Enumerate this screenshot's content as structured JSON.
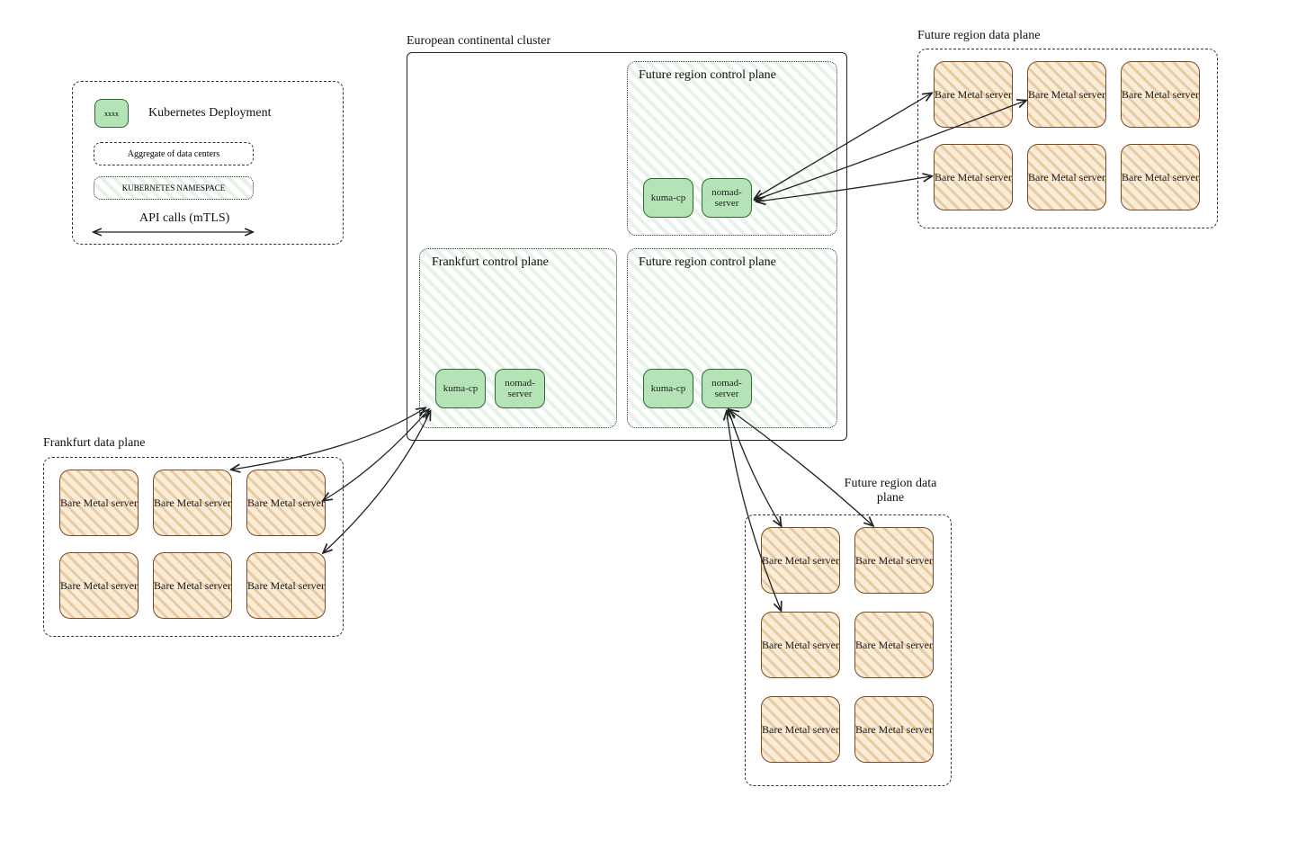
{
  "cluster": {
    "title": "European continental cluster"
  },
  "control_planes": [
    {
      "title": "Frankfurt control plane",
      "deployments": [
        "kuma-cp",
        "nomad-server"
      ]
    },
    {
      "title": "Future region control plane",
      "deployments": [
        "kuma-cp",
        "nomad-server"
      ]
    },
    {
      "title": "Future region control plane",
      "deployments": [
        "kuma-cp",
        "nomad-server"
      ]
    }
  ],
  "data_planes": {
    "frankfurt": {
      "title": "Frankfurt data plane",
      "server_label": "Bare Metal server",
      "server_count": 6
    },
    "future_top": {
      "title": "Future region data plane",
      "server_label": "Bare Metal server",
      "server_count": 6
    },
    "future_bottom": {
      "title": "Future region data plane",
      "server_label": "Bare Metal server",
      "server_count": 6
    }
  },
  "legend": {
    "deployment_swatch_text": "xxxx",
    "deployment_label": "Kubernetes Deployment",
    "aggregate_label": "Aggregate of data centers",
    "namespace_label": "KUBERNETES NAMESPACE",
    "api_label": "API calls (mTLS)"
  }
}
